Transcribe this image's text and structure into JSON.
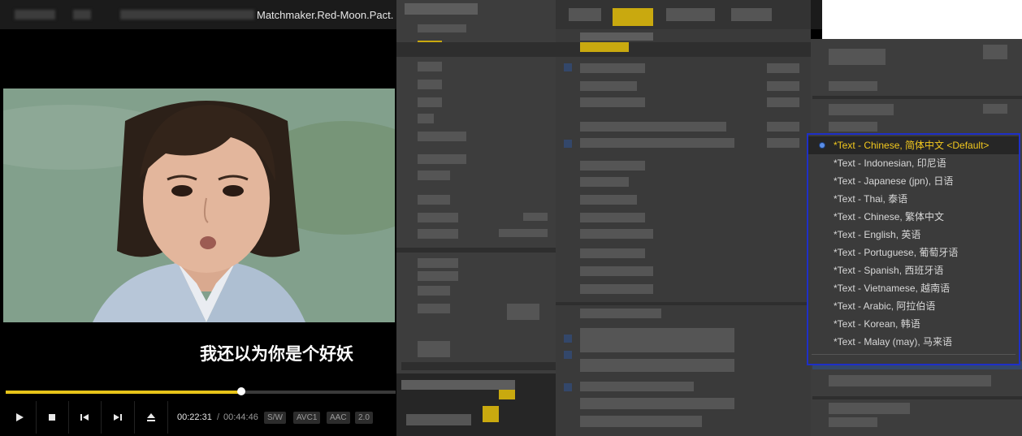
{
  "window": {
    "title": "Matchmaker.Red-Moon.Pact.",
    "close_glyph": "×"
  },
  "video": {
    "subtitle": "我还以为你是个好妖"
  },
  "playback": {
    "progress": 0.605,
    "current_time": "00:22:31",
    "separator": "/",
    "duration": "00:44:46"
  },
  "controls": {
    "play_icon": "play-icon",
    "stop_icon": "stop-icon",
    "prev_icon": "previous-icon",
    "next_icon": "next-icon",
    "eject_icon": "eject-icon"
  },
  "badges": [
    "S/W",
    "AVC1",
    "AAC",
    "2.0"
  ],
  "subtitle_menu": {
    "items": [
      {
        "label": "*Text - Chinese, 简体中文  <Default>",
        "selected": true
      },
      {
        "label": "*Text - Indonesian, 印尼语",
        "selected": false
      },
      {
        "label": "*Text - Japanese (jpn), 日语",
        "selected": false
      },
      {
        "label": "*Text - Thai, 泰语",
        "selected": false
      },
      {
        "label": "*Text - Chinese, 繁体中文",
        "selected": false
      },
      {
        "label": "*Text - English, 英语",
        "selected": false
      },
      {
        "label": "*Text - Portuguese, 葡萄牙语",
        "selected": false
      },
      {
        "label": "*Text - Spanish, 西班牙语",
        "selected": false
      },
      {
        "label": "*Text - Vietnamese, 越南语",
        "selected": false
      },
      {
        "label": "*Text - Arabic, 阿拉伯语",
        "selected": false
      },
      {
        "label": "*Text - Korean, 韩语",
        "selected": false
      },
      {
        "label": "*Text - Malay (may), 马来语",
        "selected": false
      }
    ]
  },
  "colors": {
    "accent": "#e8c419",
    "selected_text": "#f2c81e",
    "menu_border": "#1e2fc8"
  }
}
